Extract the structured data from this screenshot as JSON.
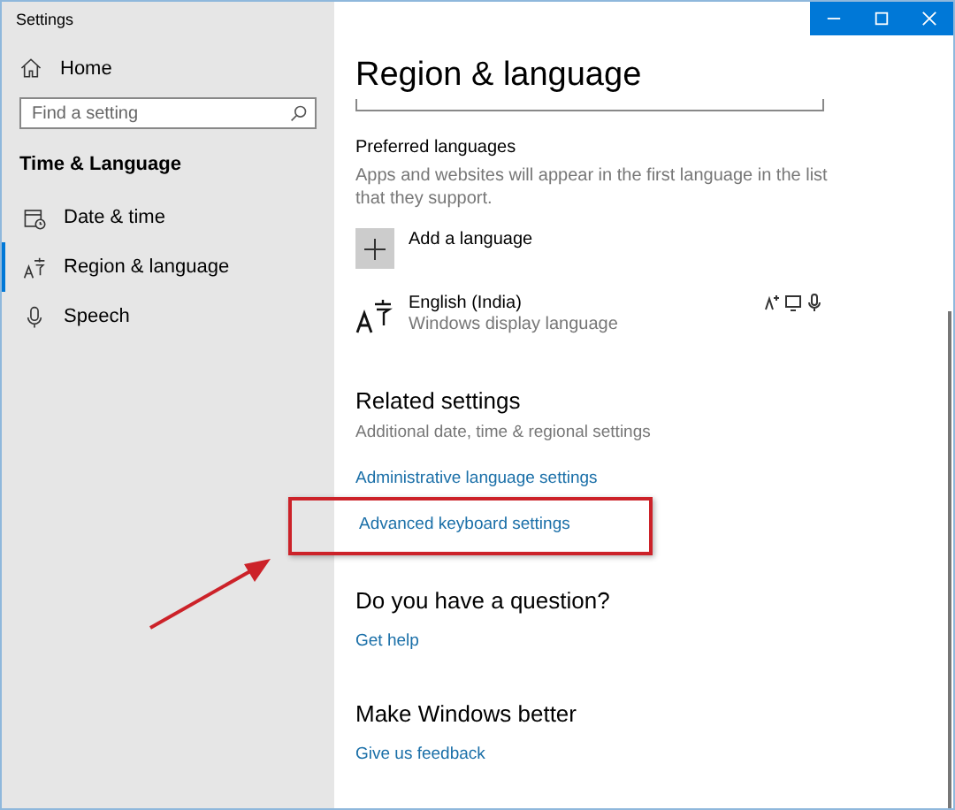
{
  "window": {
    "title": "Settings"
  },
  "sidebar": {
    "home": "Home",
    "search": {
      "placeholder": "Find a setting"
    },
    "section": "Time & Language",
    "items": [
      {
        "label": "Date & time",
        "kind": "calendar",
        "selected": false
      },
      {
        "label": "Region & language",
        "kind": "language",
        "selected": true
      },
      {
        "label": "Speech",
        "kind": "microphone",
        "selected": false
      }
    ]
  },
  "page": {
    "title": "Region & language",
    "preferred": {
      "heading": "Preferred languages",
      "description": "Apps and websites will appear in the first language in the list that they support.",
      "add_label": "Add a language",
      "languages": [
        {
          "name": "English (India)",
          "detail": "Windows display language"
        }
      ]
    },
    "related": {
      "heading": "Related settings",
      "description": "Additional date, time & regional settings",
      "links": [
        {
          "label": "Administrative language settings",
          "highlighted": false
        },
        {
          "label": "Advanced keyboard settings",
          "highlighted": true
        }
      ]
    },
    "help": {
      "heading": "Do you have a question?",
      "link": "Get help"
    },
    "feedback": {
      "heading": "Make Windows better",
      "link": "Give us feedback"
    }
  }
}
